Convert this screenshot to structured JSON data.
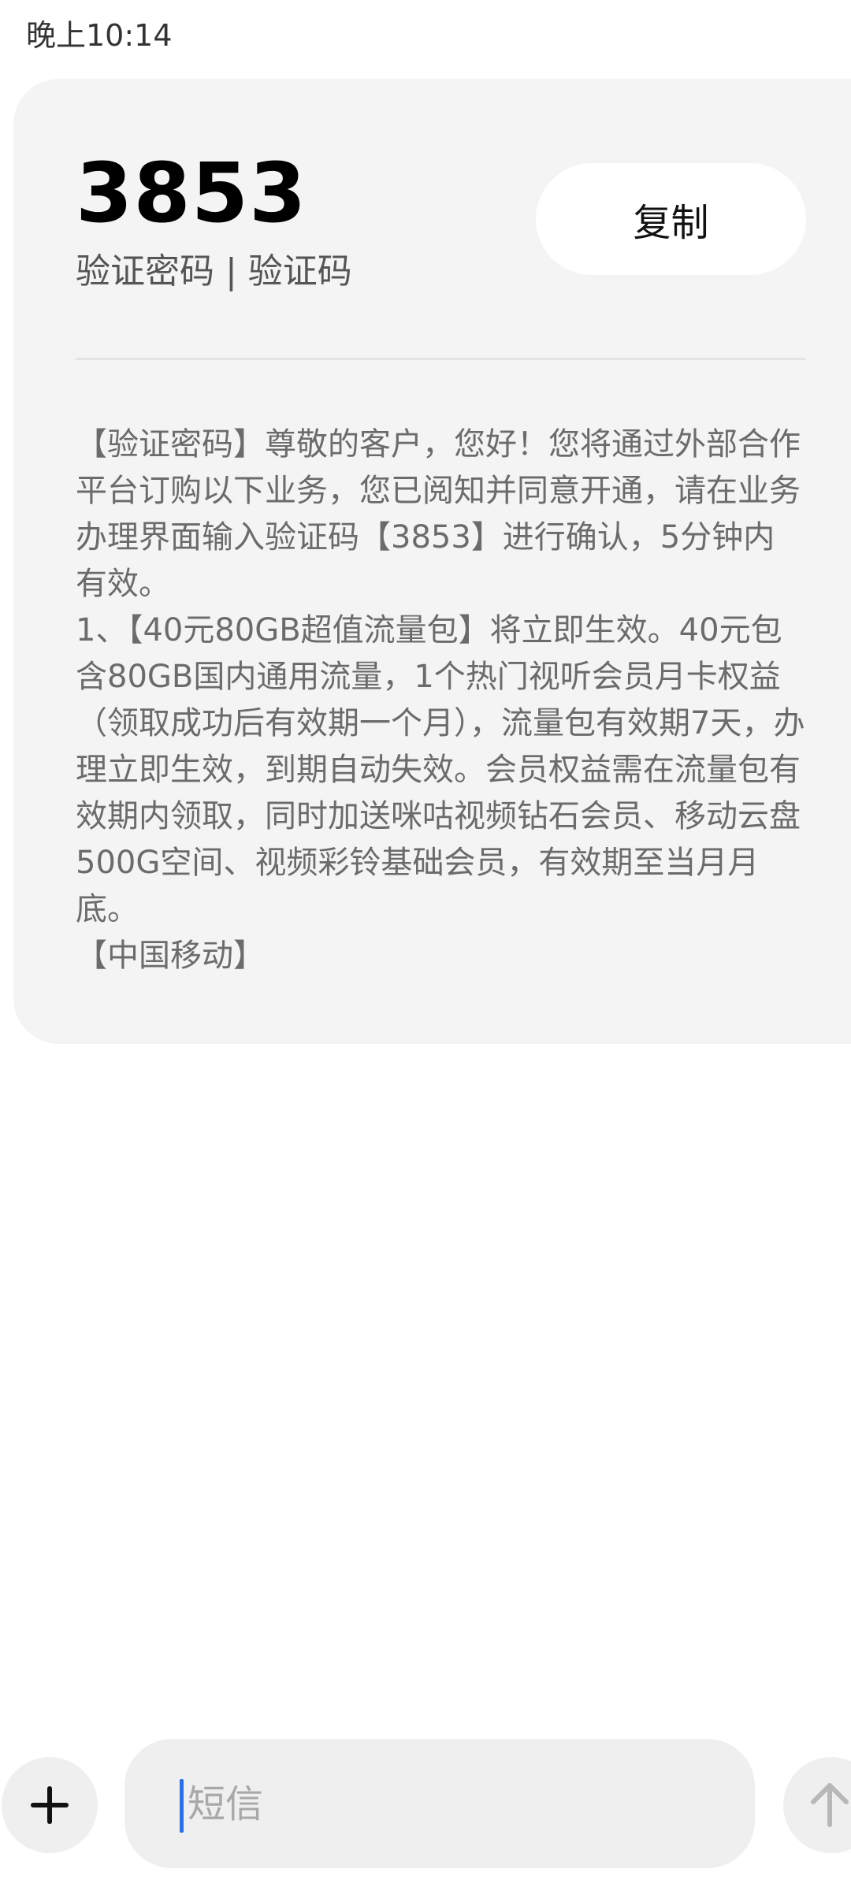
{
  "status_bar": {
    "time": "晚上10:14"
  },
  "message_card": {
    "code": "3853",
    "subtitle": "验证密码 | 验证码",
    "copy_label": "复制",
    "body": "【验证密码】尊敬的客户，您好！您将通过外部合作平台订购以下业务，您已阅知并同意开通，请在业务办理界面输入验证码【3853】进行确认，5分钟内有效。\n1、【40元80GB超值流量包】将立即生效。40元包含80GB国内通用流量，1个热门视听会员月卡权益（领取成功后有效期一个月），流量包有效期7天，办理立即生效，到期自动失效。会员权益需在流量包有效期内领取，同时加送咪咕视频钻石会员、移动云盘500G空间、视频彩铃基础会员，有效期至当月月底。\n【中国移动】"
  },
  "composer": {
    "placeholder": "短信",
    "add_icon": "plus-icon",
    "send_icon": "arrow-up-icon"
  },
  "colors": {
    "card_background": "#f4f4f4",
    "body_text": "#6b6b6b",
    "cursor": "#2a6ee8",
    "control_background": "#efefef"
  }
}
